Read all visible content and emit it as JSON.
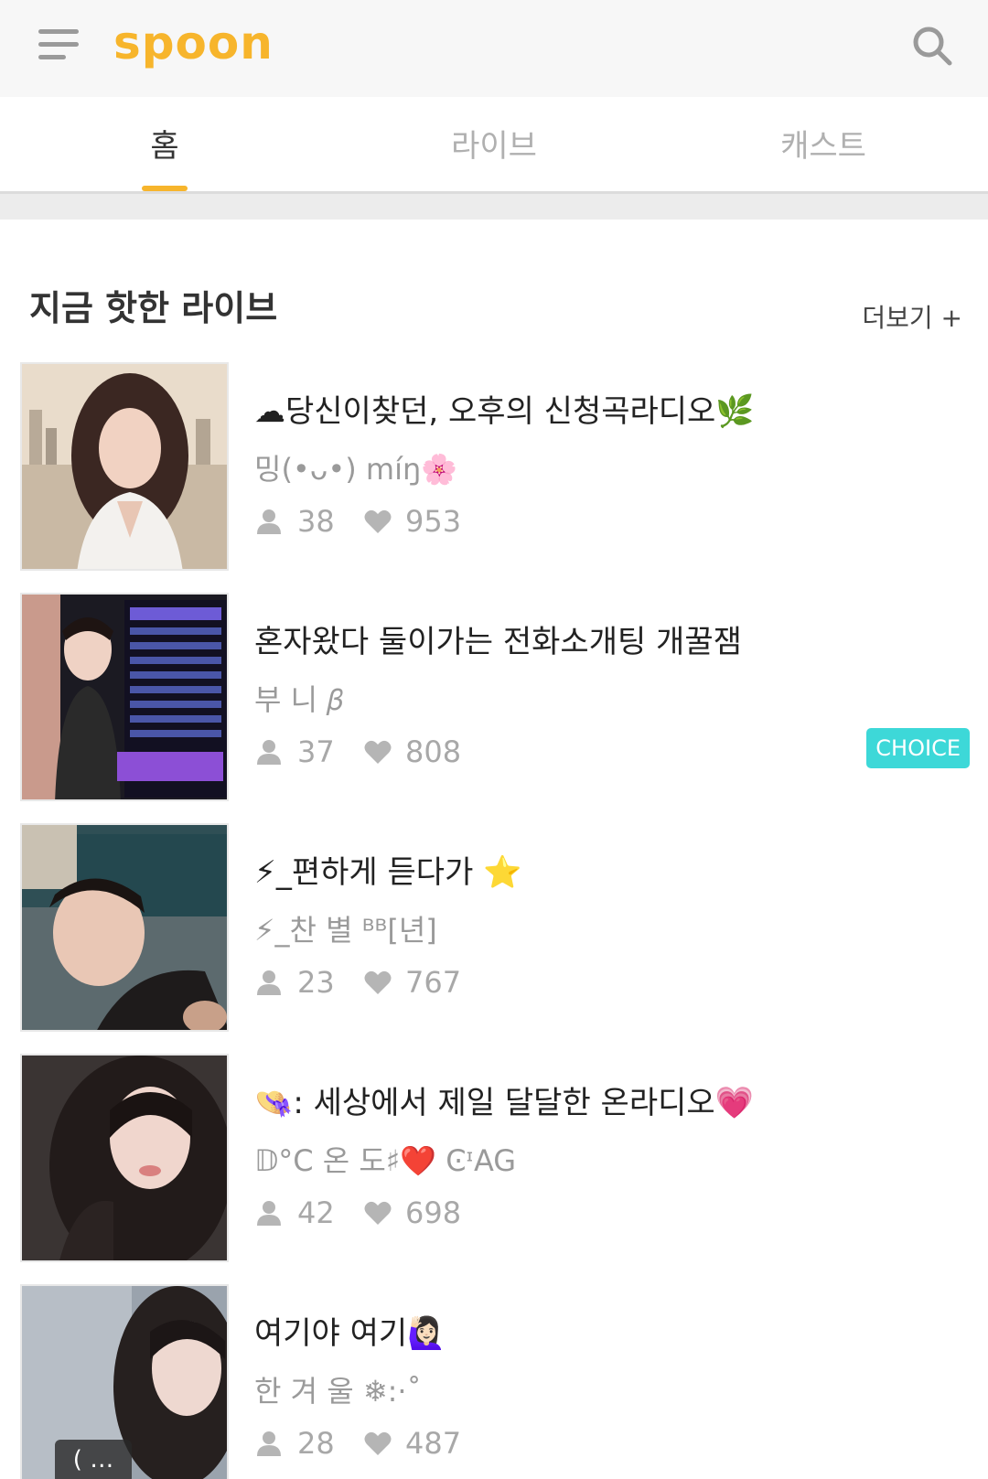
{
  "header": {
    "logo_text": "spoon",
    "menu_icon": "hamburger-menu-icon",
    "search_icon": "search-icon",
    "accent_color": "#f7b52c"
  },
  "tabs": [
    {
      "label": "홈",
      "active": true
    },
    {
      "label": "라이브",
      "active": false
    },
    {
      "label": "캐스트",
      "active": false
    }
  ],
  "section": {
    "title": "지금 핫한 라이브",
    "more_label": "더보기 +"
  },
  "lives": [
    {
      "title": "☁당신이찾던, 오후의 신청곡라디오🌿",
      "author": "밍(•ᴗ•) míŋ🌸",
      "listeners": "38",
      "likes": "953",
      "choice": ""
    },
    {
      "title": "혼자왔다 둘이가는 전화소개팅 개꿀잼",
      "author": "부 니 𝛽",
      "listeners": "37",
      "likes": "808",
      "choice": "CHOICE"
    },
    {
      "title": "⚡_편하게 듣다가 ⭐",
      "author": "⚡_찬 별 ᴮᴮ[년]",
      "listeners": "23",
      "likes": "767",
      "choice": ""
    },
    {
      "title": "👒: 세상에서 제일 달달한 온라디오💗",
      "author": "𝔻°C 온 도♯❤️ ϾᶦAG",
      "listeners": "42",
      "likes": "698",
      "choice": ""
    },
    {
      "title": "여기야 여기🙋🏻‍♀️",
      "author": "한 겨 울 ❄︎:·˚",
      "listeners": "28",
      "likes": "487",
      "choice": ""
    }
  ],
  "call_badge": "( …",
  "icons": {
    "listener": "person-icon",
    "like": "heart-icon"
  },
  "colors": {
    "choice_badge": "#3dd8d8",
    "muted_text": "#a8a8a8"
  }
}
